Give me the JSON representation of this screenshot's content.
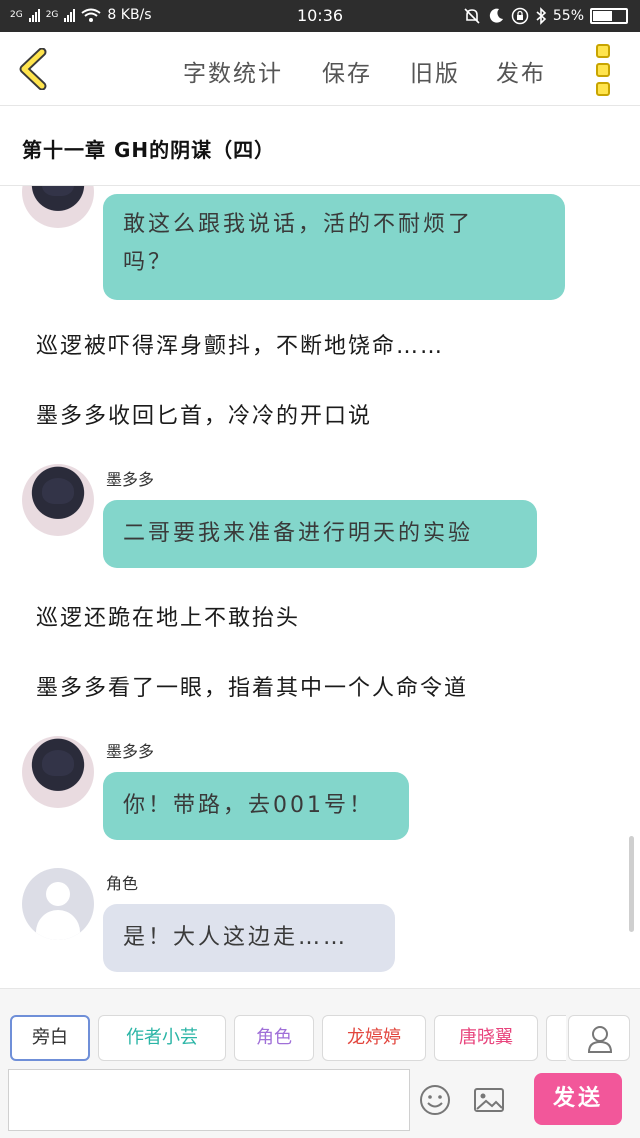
{
  "status_bar": {
    "network_1": "2G",
    "network_2": "2G",
    "speed": "8 KB/s",
    "time": "10:36",
    "battery": "55%"
  },
  "toolbar": {
    "word_count": "字数统计",
    "save": "保存",
    "old_version": "旧版",
    "publish": "发布"
  },
  "chapter": {
    "title": "第十一章 GH的阴谋（四）"
  },
  "messages": [
    {
      "type": "bubble",
      "text_line1": "敢这么跟我说话，活的不耐烦了",
      "text_line2": "吗？"
    },
    {
      "type": "narration",
      "text": "巡逻被吓得浑身颤抖，不断地饶命……"
    },
    {
      "type": "narration",
      "text": "墨多多收回匕首，冷冷的开口说"
    },
    {
      "type": "bubble",
      "name": "墨多多",
      "text": "二哥要我来准备进行明天的实验"
    },
    {
      "type": "narration",
      "text": "巡逻还跪在地上不敢抬头"
    },
    {
      "type": "narration",
      "text": "墨多多看了一眼，指着其中一个人命令道"
    },
    {
      "type": "bubble",
      "name": "墨多多",
      "text": "你！带路，去001号！"
    },
    {
      "type": "bubble",
      "name": "角色",
      "text": "是！大人这边走……"
    }
  ],
  "role_tabs": [
    {
      "label": "旁白",
      "color": "#333333"
    },
    {
      "label": "作者小芸",
      "color": "#2bb5a6"
    },
    {
      "label": "角色",
      "color": "#a070d8"
    },
    {
      "label": "龙婷婷",
      "color": "#e2463e"
    },
    {
      "label": "唐晓翼",
      "color": "#e8457d"
    }
  ],
  "composer": {
    "input_value": "",
    "send_label": "发送"
  },
  "colors": {
    "teal_bubble": "#83d6cb",
    "grey_bubble": "#dee2ed",
    "send_button": "#f2579a",
    "accent_yellow": "#ffe44d"
  },
  "icons": [
    "back-chevron-icon",
    "more-menu-icon",
    "user-icon",
    "emoji-icon",
    "image-icon"
  ]
}
